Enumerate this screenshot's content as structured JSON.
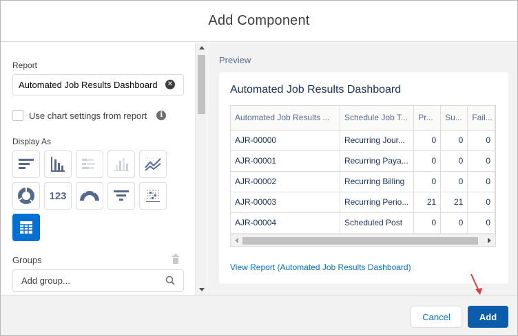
{
  "modal": {
    "title": "Add Component"
  },
  "left": {
    "report_label": "Report",
    "report_value": "Automated Job Results Dashboard",
    "use_chart_settings_label": "Use chart settings from report",
    "display_as_label": "Display As",
    "display_options": [
      {
        "icon": "horizontal-bar-chart-icon"
      },
      {
        "icon": "vertical-bar-chart-icon"
      },
      {
        "icon": "stacked-horizontal-bar-icon"
      },
      {
        "icon": "stacked-vertical-bar-icon"
      },
      {
        "icon": "line-chart-icon"
      },
      {
        "icon": "donut-chart-icon"
      },
      {
        "icon": "metric-icon",
        "text": "123"
      },
      {
        "icon": "gauge-icon"
      },
      {
        "icon": "funnel-chart-icon"
      },
      {
        "icon": "scatter-chart-icon"
      },
      {
        "icon": "table-icon",
        "selected": true
      }
    ],
    "groups_label": "Groups",
    "group_placeholder": "Add group..."
  },
  "preview": {
    "label": "Preview",
    "card_title": "Automated Job Results Dashboard",
    "columns": [
      "Automated Job Results ...",
      "Schedule Job T...",
      "Pr...",
      "Su...",
      "Fail..."
    ],
    "rows": [
      [
        "AJR-00000",
        "Recurring Jour...",
        "0",
        "0",
        "0"
      ],
      [
        "AJR-00001",
        "Recurring Paya...",
        "0",
        "0",
        "0"
      ],
      [
        "AJR-00002",
        "Recurring Billing",
        "0",
        "0",
        "0"
      ],
      [
        "AJR-00003",
        "Recurring Perio...",
        "21",
        "21",
        "0"
      ],
      [
        "AJR-00004",
        "Scheduled Post",
        "0",
        "0",
        "0"
      ]
    ],
    "view_report_link": "View Report (Automated Job Results Dashboard)"
  },
  "footer": {
    "cancel_label": "Cancel",
    "add_label": "Add"
  },
  "colors": {
    "brand": "#0070d2",
    "add_button": "#0b5cab",
    "annotation_arrow": "#e03a3a"
  }
}
